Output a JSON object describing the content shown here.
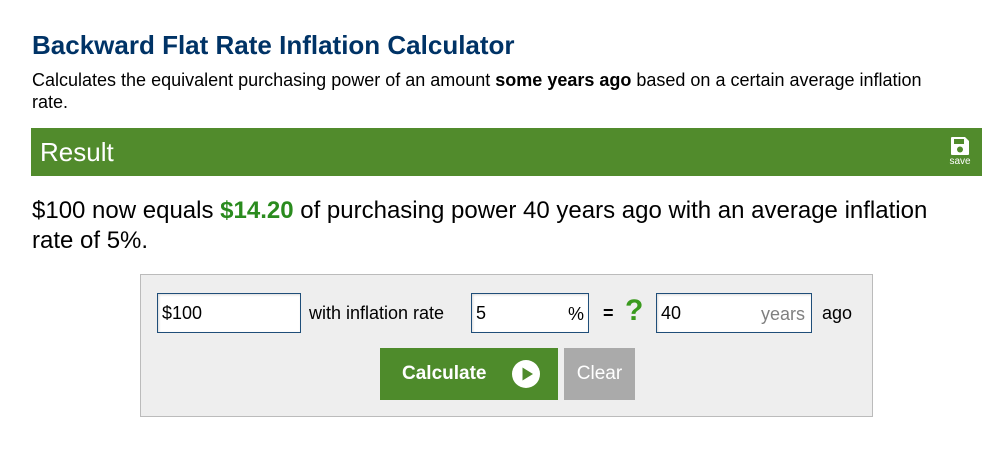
{
  "header": {
    "title": "Backward Flat Rate Inflation Calculator",
    "desc_part1": "Calculates the equivalent purchasing power of an amount ",
    "desc_bold": "some years ago",
    "desc_part2": " based on a certain average inflation rate."
  },
  "result": {
    "title": "Result",
    "save_label": "save",
    "save_icon": "floppy-disk-icon",
    "text_before": "$100 now equals ",
    "value": "$14.20",
    "text_after": " of purchasing power 40 years ago with an average inflation rate of 5%."
  },
  "form": {
    "amount_value": "$100",
    "with_label": "with inflation rate",
    "rate_value": "5",
    "rate_unit": "%",
    "equals": "=",
    "question": "?",
    "years_value": "40",
    "years_unit": "years",
    "ago_label": "ago"
  },
  "buttons": {
    "calculate_label": "Calculate",
    "calculate_icon": "play-circle-icon",
    "clear_label": "Clear"
  },
  "colors": {
    "title": "#003366",
    "result_bar": "#518b2c",
    "result_value": "#2a8b1e",
    "question_mark": "#3a9a1e",
    "calculate_button": "#4e8b2b",
    "clear_button": "#aaaaaa"
  }
}
